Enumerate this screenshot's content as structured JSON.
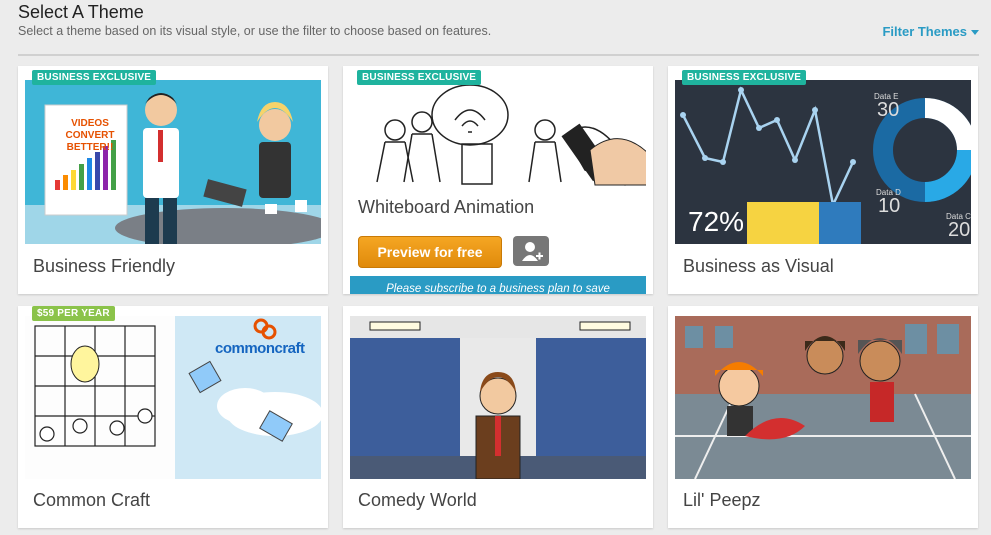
{
  "header": {
    "title": "Select A Theme",
    "subtitle": "Select a theme based on its visual style, or use the filter to choose based on features.",
    "filter_label": "Filter Themes"
  },
  "themes": [
    {
      "name": "Business Friendly",
      "badge": "BUSINESS EXCLUSIVE",
      "thumb_text": "VIDEOS CONVERT BETTER!!"
    },
    {
      "name": "Whiteboard Animation",
      "badge": "BUSINESS EXCLUSIVE",
      "preview_label": "Preview for free",
      "subscribe_note": "Please subscribe to a business plan to save"
    },
    {
      "name": "Business as Visual",
      "badge": "BUSINESS EXCLUSIVE",
      "stats": {
        "percent": "72%",
        "data_e_label": "Data E",
        "data_e": "30",
        "data_d_label": "Data D",
        "data_d": "10",
        "data_c_label": "Data C",
        "data_c": "20"
      }
    },
    {
      "name": "Common Craft",
      "badge": "$59 PER YEAR",
      "logo_text": "commoncraft"
    },
    {
      "name": "Comedy World"
    },
    {
      "name": "Lil' Peepz"
    }
  ],
  "colors": {
    "accent": "#2a9bc4",
    "badge_teal": "#1fb39e",
    "badge_green": "#8bc34a",
    "preview_orange": "#f5a623"
  }
}
